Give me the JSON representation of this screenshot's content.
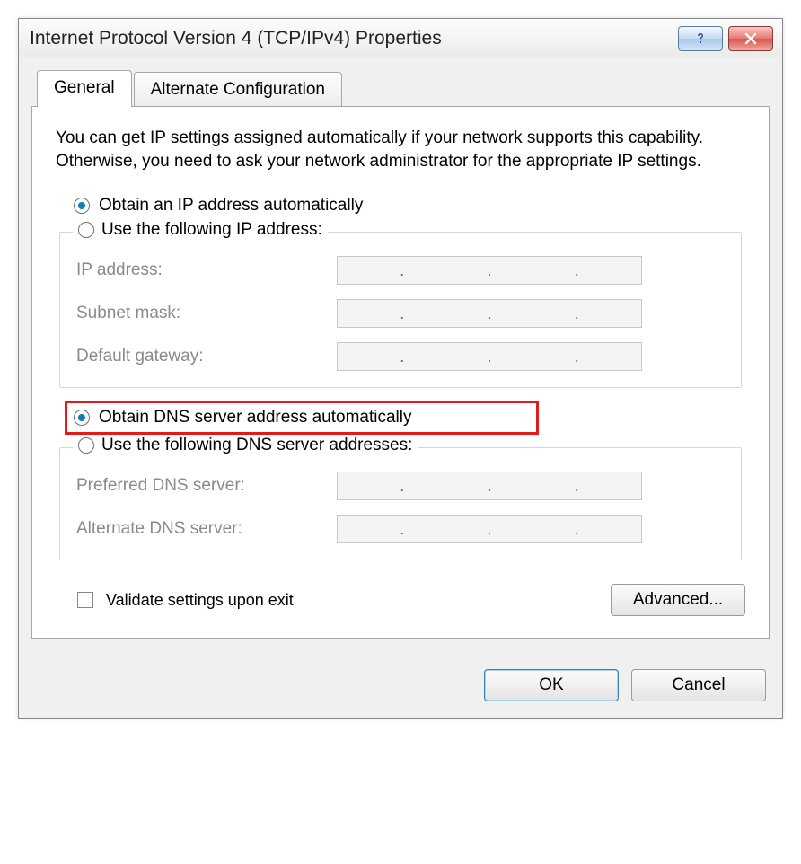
{
  "title": "Internet Protocol Version 4 (TCP/IPv4) Properties",
  "tabs": {
    "general": "General",
    "alternate": "Alternate Configuration"
  },
  "description": "You can get IP settings assigned automatically if your network supports this capability. Otherwise, you need to ask your network administrator for the appropriate IP settings.",
  "ip": {
    "auto_label": "Obtain an IP address automatically",
    "manual_label": "Use the following IP address:",
    "fields": {
      "ip_address": "IP address:",
      "subnet_mask": "Subnet mask:",
      "default_gateway": "Default gateway:"
    },
    "auto_selected": true
  },
  "dns": {
    "auto_label": "Obtain DNS server address automatically",
    "manual_label": "Use the following DNS server addresses:",
    "fields": {
      "preferred": "Preferred DNS server:",
      "alternate": "Alternate DNS server:"
    },
    "auto_selected": true
  },
  "validate_label": "Validate settings upon exit",
  "advanced_label": "Advanced...",
  "ok_label": "OK",
  "cancel_label": "Cancel"
}
